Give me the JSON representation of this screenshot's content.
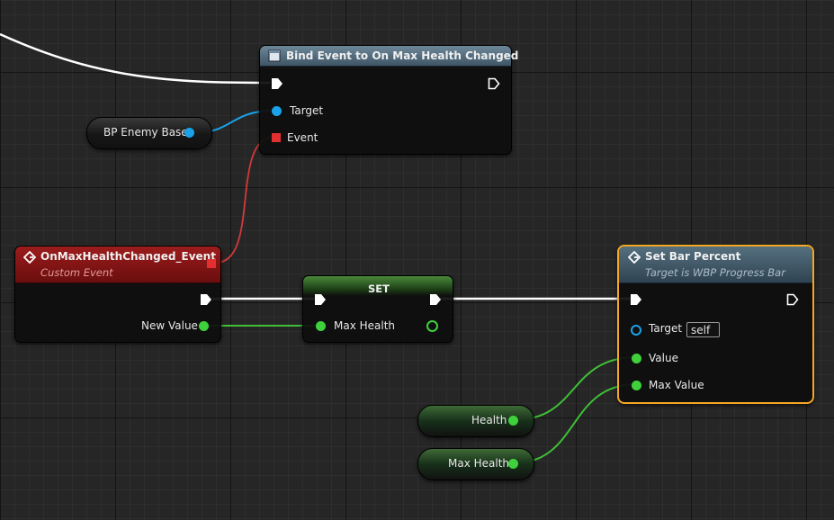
{
  "colors": {
    "exec": "#ffffff",
    "object_pin": "#1aa3e8",
    "delegate_pin": "#e23030",
    "float_pin": "#3fd13b",
    "event_header": "#8a1414",
    "function_header": "#4d6577",
    "selected_outline": "#f5a623"
  },
  "nodes": {
    "bind_event": {
      "icon": "function-icon",
      "title": "Bind Event to On Max Health Changed",
      "pins": {
        "target": "Target",
        "event": "Event"
      }
    },
    "bp_enemy_base": {
      "label": "BP Enemy Base"
    },
    "custom_event": {
      "icon": "event-diamond-icon",
      "title": "OnMaxHealthChanged_Event",
      "subtitle": "Custom Event",
      "pins": {
        "new_value": "New Value"
      }
    },
    "set_node": {
      "title": "SET",
      "pins": {
        "max_health": "Max Health"
      }
    },
    "set_bar_percent": {
      "icon": "function-icon",
      "title": "Set Bar Percent",
      "subtitle": "Target is WBP Progress Bar",
      "pins": {
        "target": "Target",
        "target_default": "self",
        "value": "Value",
        "max_value": "Max Value"
      }
    },
    "health_getter": {
      "label": "Health"
    },
    "max_health_getter": {
      "label": "Max Health"
    }
  }
}
